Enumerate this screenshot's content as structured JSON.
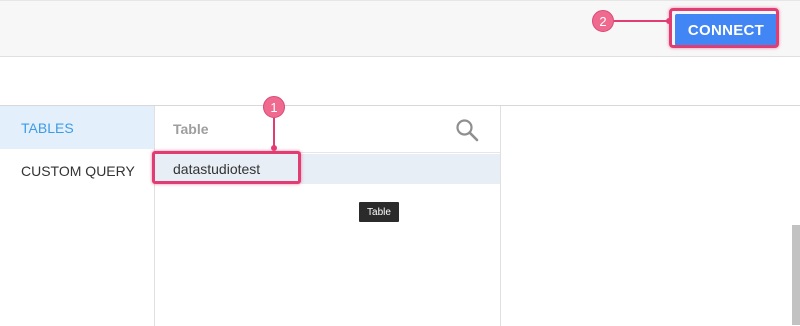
{
  "header": {
    "connect_label": "CONNECT"
  },
  "annotations": {
    "step1": "1",
    "step2": "2",
    "color": "#e23d73"
  },
  "sidebar": {
    "items": [
      {
        "label": "TABLES",
        "active": true
      },
      {
        "label": "CUSTOM QUERY",
        "active": false
      }
    ]
  },
  "table_list": {
    "search_placeholder": "Table",
    "search_icon": "search-icon",
    "rows": [
      "datastudiotest"
    ]
  },
  "tooltip": {
    "text": "Table"
  },
  "colors": {
    "accent": "#4285f4",
    "active_tab_bg": "#e3f0fb",
    "active_tab_text": "#3d9be8"
  }
}
